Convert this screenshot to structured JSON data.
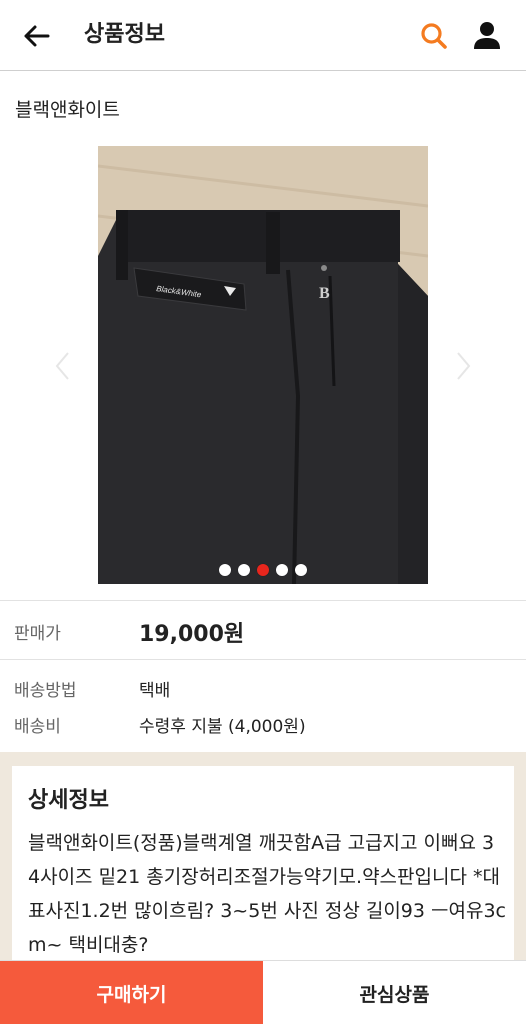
{
  "header": {
    "title": "상품정보",
    "back_icon": "arrow-left-icon",
    "search_icon": "search-icon",
    "user_icon": "user-icon",
    "accent_color": "#f47b20"
  },
  "product": {
    "brand": "블랙앤화이트",
    "image_logo_text": "Black&White",
    "gallery": {
      "total_images": 5,
      "active_index": 2,
      "dot_active_color": "#e8261d"
    }
  },
  "info": {
    "price_label": "판매가",
    "price_value": "19,000원",
    "shipping_method_label": "배송방법",
    "shipping_method_value": "택배",
    "shipping_fee_label": "배송비",
    "shipping_fee_value": "수령후 지불 (4,000원)"
  },
  "detail": {
    "title": "상세정보",
    "text": "블랙앤화이트(정품)블랙계열 깨끗함A급 고급지고 이뻐요 34사이즈 밑21 총기장허리조절가능약기모.약스판입니다 *대표사진1.2번 많이흐림? 3~5번 사진 정상 길이93 ㅡ여유3cm~ 택비대충?"
  },
  "bottom": {
    "buy_label": "구매하기",
    "wish_label": "관심상품",
    "buy_color": "#f55a3c"
  }
}
